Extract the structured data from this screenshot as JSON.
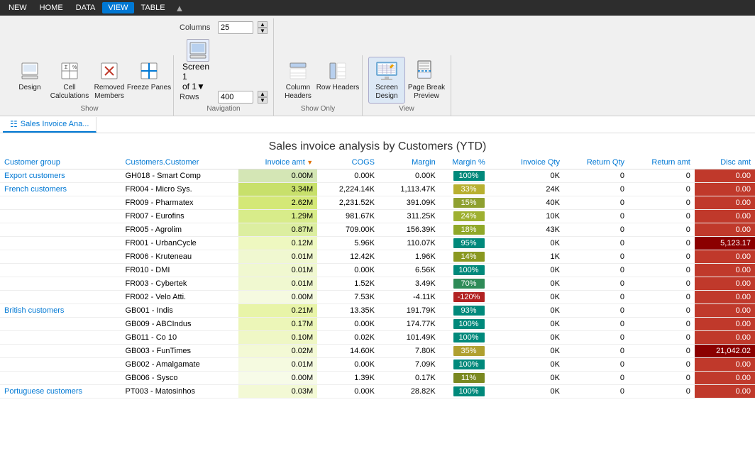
{
  "menu": {
    "items": [
      "NEW",
      "HOME",
      "DATA",
      "VIEW",
      "TABLE"
    ]
  },
  "ribbon": {
    "groups": {
      "show": {
        "label": "Show",
        "buttons": [
          {
            "id": "design",
            "label": "Design"
          },
          {
            "id": "cell-calculations",
            "label": "Cell\nCalculations"
          },
          {
            "id": "removed-members",
            "label": "Removed\nMembers"
          },
          {
            "id": "freeze-panes",
            "label": "Freeze\nPanes"
          }
        ]
      },
      "navigation": {
        "label": "Navigation",
        "columns_label": "Columns",
        "columns_value": "25",
        "rows_label": "Rows",
        "rows_value": "400",
        "screen_label": "Screen\n1\nof 1▾"
      },
      "show_only": {
        "label": "Show Only",
        "buttons": [
          {
            "id": "column-headers",
            "label": "Column\nHeaders"
          },
          {
            "id": "row-headers",
            "label": "Row Headers"
          }
        ]
      },
      "view": {
        "label": "View",
        "buttons": [
          {
            "id": "screen-design",
            "label": "Screen\nDesign",
            "active": true
          },
          {
            "id": "page-break-preview",
            "label": "Page Break\nPreview"
          }
        ]
      }
    }
  },
  "tab": {
    "label": "Sales Invoice Ana..."
  },
  "table": {
    "title": "Sales invoice analysis by Customers (YTD)",
    "columns": [
      {
        "id": "customer-group",
        "label": "Customer group"
      },
      {
        "id": "customer",
        "label": "Customers.Customer"
      },
      {
        "id": "invoice-amt",
        "label": "Invoice amt"
      },
      {
        "id": "cogs",
        "label": "COGS"
      },
      {
        "id": "margin",
        "label": "Margin"
      },
      {
        "id": "margin-pct",
        "label": "Margin %"
      },
      {
        "id": "invoice-qty",
        "label": "Invoice Qty"
      },
      {
        "id": "return-qty",
        "label": "Return Qty"
      },
      {
        "id": "return-amt",
        "label": "Return amt"
      },
      {
        "id": "disc-amt",
        "label": "Disc amt"
      }
    ],
    "rows": [
      {
        "group": "Export customers",
        "customer": "GH018 - Smart Comp",
        "invoice_amt": "0.00M",
        "cogs": "0.00K",
        "margin": "0.00K",
        "margin_pct": "100%",
        "invoice_qty": "0K",
        "return_qty": "0",
        "return_amt": "0",
        "disc_amt": "0.00",
        "inv_color": "#d4e6b5",
        "pct_color": "#00897b",
        "disc_color": "#c0392b"
      },
      {
        "group": "French customers",
        "customer": "FR004 - Micro Sys.",
        "invoice_amt": "3.34M",
        "cogs": "2,224.14K",
        "margin": "1,113.47K",
        "margin_pct": "33%",
        "invoice_qty": "24K",
        "return_qty": "0",
        "return_amt": "0",
        "disc_amt": "0.00",
        "inv_color": "#c8e06b",
        "pct_color": "#b8b030",
        "disc_color": "#c0392b"
      },
      {
        "group": "",
        "customer": "FR009 - Pharmatex",
        "invoice_amt": "2.62M",
        "cogs": "2,231.52K",
        "margin": "391.09K",
        "margin_pct": "15%",
        "invoice_qty": "40K",
        "return_qty": "0",
        "return_amt": "0",
        "disc_amt": "0.00",
        "inv_color": "#d4e877",
        "pct_color": "#8ea030",
        "disc_color": "#c0392b"
      },
      {
        "group": "",
        "customer": "FR007 - Eurofins",
        "invoice_amt": "1.29M",
        "cogs": "981.67K",
        "margin": "311.25K",
        "margin_pct": "24%",
        "invoice_qty": "10K",
        "return_qty": "0",
        "return_amt": "0",
        "disc_amt": "0.00",
        "inv_color": "#d8ec8a",
        "pct_color": "#9eb030",
        "disc_color": "#c0392b"
      },
      {
        "group": "",
        "customer": "FR005 - Agrolim",
        "invoice_amt": "0.87M",
        "cogs": "709.00K",
        "margin": "156.39K",
        "margin_pct": "18%",
        "invoice_qty": "43K",
        "return_qty": "0",
        "return_amt": "0",
        "disc_amt": "0.00",
        "inv_color": "#dceea0",
        "pct_color": "#90a828",
        "disc_color": "#c0392b"
      },
      {
        "group": "",
        "customer": "FR001 - UrbanCycle",
        "invoice_amt": "0.12M",
        "cogs": "5.96K",
        "margin": "110.07K",
        "margin_pct": "95%",
        "invoice_qty": "0K",
        "return_qty": "0",
        "return_amt": "0",
        "disc_amt": "5,123.17",
        "inv_color": "#eef8c0",
        "pct_color": "#00897b",
        "disc_color": "#8b0000"
      },
      {
        "group": "",
        "customer": "FR006 - Kruteneau",
        "invoice_amt": "0.01M",
        "cogs": "12.42K",
        "margin": "1.96K",
        "margin_pct": "14%",
        "invoice_qty": "1K",
        "return_qty": "0",
        "return_amt": "0",
        "disc_amt": "0.00",
        "inv_color": "#f0f8d0",
        "pct_color": "#8a9820",
        "disc_color": "#c0392b"
      },
      {
        "group": "",
        "customer": "FR010 - DMI",
        "invoice_amt": "0.01M",
        "cogs": "0.00K",
        "margin": "6.56K",
        "margin_pct": "100%",
        "invoice_qty": "0K",
        "return_qty": "0",
        "return_amt": "0",
        "disc_amt": "0.00",
        "inv_color": "#f0f8d0",
        "pct_color": "#00897b",
        "disc_color": "#c0392b"
      },
      {
        "group": "",
        "customer": "FR003 - Cybertek",
        "invoice_amt": "0.01M",
        "cogs": "1.52K",
        "margin": "3.49K",
        "margin_pct": "70%",
        "invoice_qty": "0K",
        "return_qty": "0",
        "return_amt": "0",
        "disc_amt": "0.00",
        "inv_color": "#f0f8d0",
        "pct_color": "#2e8b57",
        "disc_color": "#c0392b"
      },
      {
        "group": "",
        "customer": "FR002 - Velo Atti.",
        "invoice_amt": "0.00M",
        "cogs": "7.53K",
        "margin": "-4.11K",
        "margin_pct": "-120%",
        "invoice_qty": "0K",
        "return_qty": "0",
        "return_amt": "0",
        "disc_amt": "0.00",
        "inv_color": "#f5fae0",
        "pct_color": "#b22222",
        "disc_color": "#c0392b"
      },
      {
        "group": "British customers",
        "customer": "GB001 - Indis",
        "invoice_amt": "0.21M",
        "cogs": "13.35K",
        "margin": "191.79K",
        "margin_pct": "93%",
        "invoice_qty": "0K",
        "return_qty": "0",
        "return_amt": "0",
        "disc_amt": "0.00",
        "inv_color": "#e8f4a8",
        "pct_color": "#00897b",
        "disc_color": "#c0392b"
      },
      {
        "group": "",
        "customer": "GB009 - ABCIndus",
        "invoice_amt": "0.17M",
        "cogs": "0.00K",
        "margin": "174.77K",
        "margin_pct": "100%",
        "invoice_qty": "0K",
        "return_qty": "0",
        "return_amt": "0",
        "disc_amt": "0.00",
        "inv_color": "#ecf6b8",
        "pct_color": "#00897b",
        "disc_color": "#c0392b"
      },
      {
        "group": "",
        "customer": "GB011 - Co 10",
        "invoice_amt": "0.10M",
        "cogs": "0.02K",
        "margin": "101.49K",
        "margin_pct": "100%",
        "invoice_qty": "0K",
        "return_qty": "0",
        "return_amt": "0",
        "disc_amt": "0.00",
        "inv_color": "#eff7c5",
        "pct_color": "#00897b",
        "disc_color": "#c0392b"
      },
      {
        "group": "",
        "customer": "GB003 - FunTimes",
        "invoice_amt": "0.02M",
        "cogs": "14.60K",
        "margin": "7.80K",
        "margin_pct": "35%",
        "invoice_qty": "0K",
        "return_qty": "0",
        "return_amt": "0",
        "disc_amt": "21,042.02",
        "inv_color": "#f3f9d5",
        "pct_color": "#b0a030",
        "disc_color": "#8b0000"
      },
      {
        "group": "",
        "customer": "GB002 - Amalgamate",
        "invoice_amt": "0.01M",
        "cogs": "0.00K",
        "margin": "7.09K",
        "margin_pct": "100%",
        "invoice_qty": "0K",
        "return_qty": "0",
        "return_amt": "0",
        "disc_amt": "0.00",
        "inv_color": "#f5fae0",
        "pct_color": "#00897b",
        "disc_color": "#c0392b"
      },
      {
        "group": "",
        "customer": "GB006 - Sysco",
        "invoice_amt": "0.00M",
        "cogs": "1.39K",
        "margin": "0.17K",
        "margin_pct": "11%",
        "invoice_qty": "0K",
        "return_qty": "0",
        "return_amt": "0",
        "disc_amt": "0.00",
        "inv_color": "#f7fbe8",
        "pct_color": "#7a8820",
        "disc_color": "#c0392b"
      },
      {
        "group": "Portuguese customers",
        "customer": "PT003 - Matosinhos",
        "invoice_amt": "0.03M",
        "cogs": "0.00K",
        "margin": "28.82K",
        "margin_pct": "100%",
        "invoice_qty": "0K",
        "return_qty": "0",
        "return_amt": "0",
        "disc_amt": "0.00",
        "inv_color": "#f3f9d5",
        "pct_color": "#00897b",
        "disc_color": "#c0392b"
      }
    ]
  }
}
